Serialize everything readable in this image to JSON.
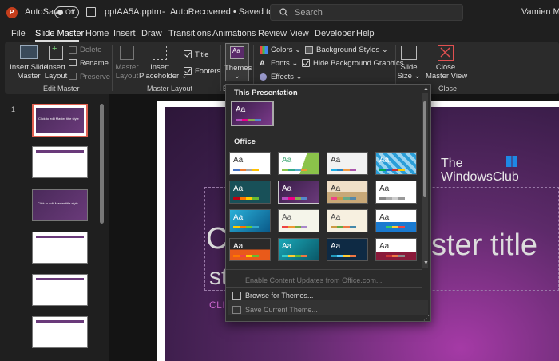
{
  "titlebar": {
    "autosave_label": "AutoSave",
    "autosave_state": "Off",
    "filename": "pptAA5A.pptm",
    "separator": "-",
    "status": "AutoRecovered • Saved to this PC",
    "search_placeholder": "Search",
    "user": "Vamien McK"
  },
  "menu": [
    "File",
    "Slide Master",
    "Home",
    "Insert",
    "Draw",
    "Transitions",
    "Animations",
    "Review",
    "View",
    "Developer",
    "Help"
  ],
  "ribbon": {
    "insert_slide_master": [
      "Insert Slide",
      "Master"
    ],
    "insert_layout": [
      "Insert",
      "Layout"
    ],
    "delete": "Delete",
    "rename": "Rename",
    "preserve": "Preserve",
    "edit_master_group": "Edit Master",
    "master_layout": [
      "Master",
      "Layout"
    ],
    "insert_placeholder": [
      "Insert",
      "Placeholder ⌄"
    ],
    "title_check": "Title",
    "footers_check": "Footers",
    "master_layout_group": "Master Layout",
    "themes": [
      "Themes",
      "⌄"
    ],
    "edit_theme_group": "E",
    "colors": "Colors ⌄",
    "fonts": "Fonts ⌄",
    "effects": "Effects ⌄",
    "background_styles": "Background Styles ⌄",
    "hide_bg_graphics": "Hide Background Graphics",
    "slide_size": [
      "Slide",
      "Size ⌄"
    ],
    "close_master_view": [
      "Close",
      "Master View"
    ],
    "close_group": "Close"
  },
  "thumbs": {
    "first_number": "1",
    "first_title": "Click to edit Master title style",
    "layout_title": "Click to edit Master title style"
  },
  "slide": {
    "title_part1": "C",
    "title_part2": "ster title",
    "title_line2": "st",
    "subtitle": "CLIC"
  },
  "watermark": [
    "The",
    "WindowsClub"
  ],
  "dropdown": {
    "this_presentation": "This Presentation",
    "office": "Office",
    "enable_updates": "Enable Content Updates from Office.com...",
    "browse": "Browse for Themes...",
    "save_current": "Save Current Theme...",
    "aa": "Aa"
  }
}
